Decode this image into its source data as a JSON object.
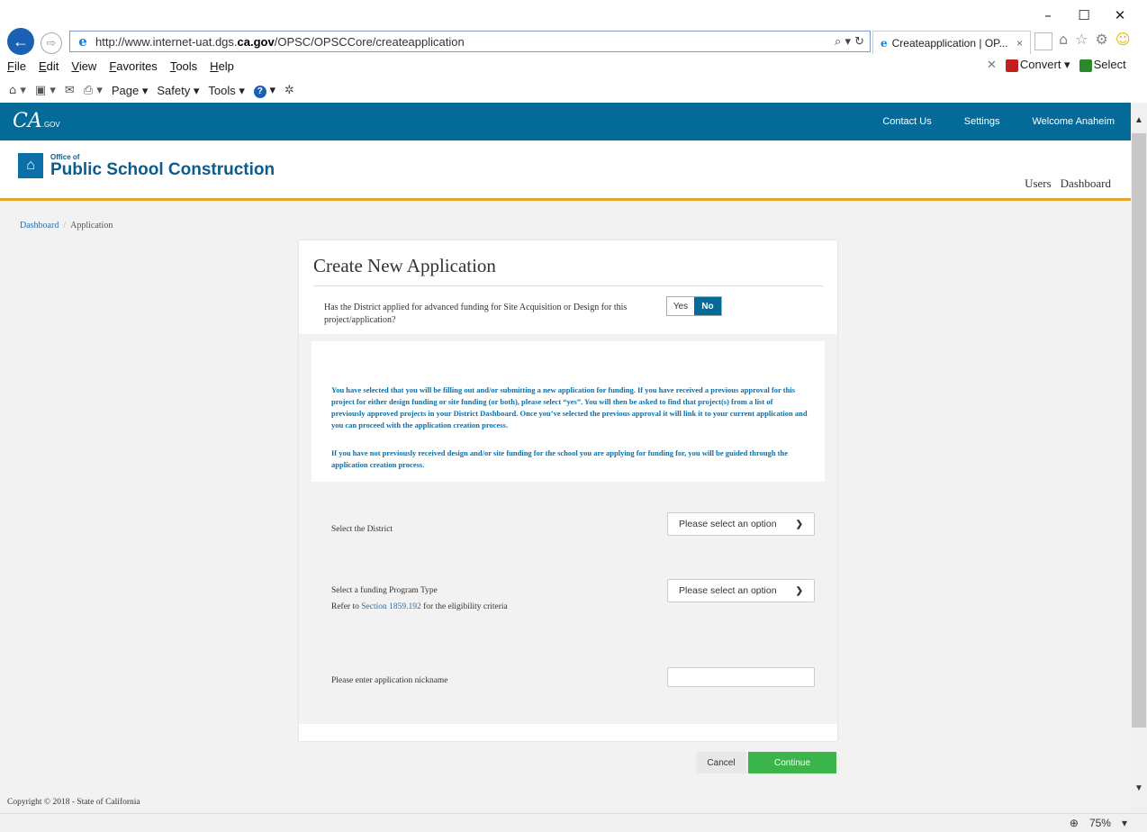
{
  "browser": {
    "url_prefix": "http://www.internet-uat.dgs.",
    "url_domain": "ca.gov",
    "url_suffix": "/OPSC/OPSCCore/createapplication",
    "address_tools": "⌕ ▾ ↻",
    "tab_title": "Createapplication | OP...",
    "tab_close": "×",
    "menu": [
      "File",
      "Edit",
      "View",
      "Favorites",
      "Tools",
      "Help"
    ],
    "convert_label": "Convert",
    "select_label": "Select",
    "cmd": {
      "page": "Page",
      "safety": "Safety",
      "tools": "Tools"
    },
    "zoom": "75%"
  },
  "topbar": {
    "logo_text": "CA",
    "logo_sub": ".GOV",
    "links": [
      "Contact Us",
      "Settings",
      "Welcome Anaheim"
    ]
  },
  "header": {
    "brand_small": "Office of",
    "brand": "Public School Construction",
    "nav": [
      "Users",
      "Dashboard"
    ]
  },
  "breadcrumb": {
    "home": "Dashboard",
    "separator": "/",
    "current": "Application"
  },
  "form": {
    "title": "Create New Application",
    "question": "Has the District applied for advanced funding for Site Acquisition or Design for this project/application?",
    "yes_label": "Yes",
    "no_label": "No",
    "info_p1": "You have selected that you will be filling out and/or submitting a new application for funding. If you have received a previous approval for this project for either design funding or site funding (or both), please select “yes”. You will then be asked to find that project(s) from a list of previously approved projects in your District Dashboard. Once you’ve selected the previous approval it will link it to your current application and you can proceed with the application creation process.",
    "info_p2": "If you have not previously received design and/or site funding for the school you are applying for funding for, you will be guided through the application creation process.",
    "district_label": "Select the District",
    "district_value": "Please select an option",
    "program_label": "Select a funding Program Type",
    "program_note_pre": "Refer to ",
    "program_note_link": "Section 1859.192",
    "program_note_post": " for the eligibility criteria",
    "program_value": "Please select an option",
    "nickname_label": "Please enter application nickname",
    "nickname_value": "",
    "cancel_label": "Cancel",
    "continue_label": "Continue"
  },
  "footer": {
    "copyright": "Copyright © 2018 - State of California"
  },
  "colors": {
    "ca_blue": "#046b99",
    "accent_gold": "#e6a42a",
    "continue_green": "#3bb54a",
    "info_text": "#0c6fa8"
  }
}
